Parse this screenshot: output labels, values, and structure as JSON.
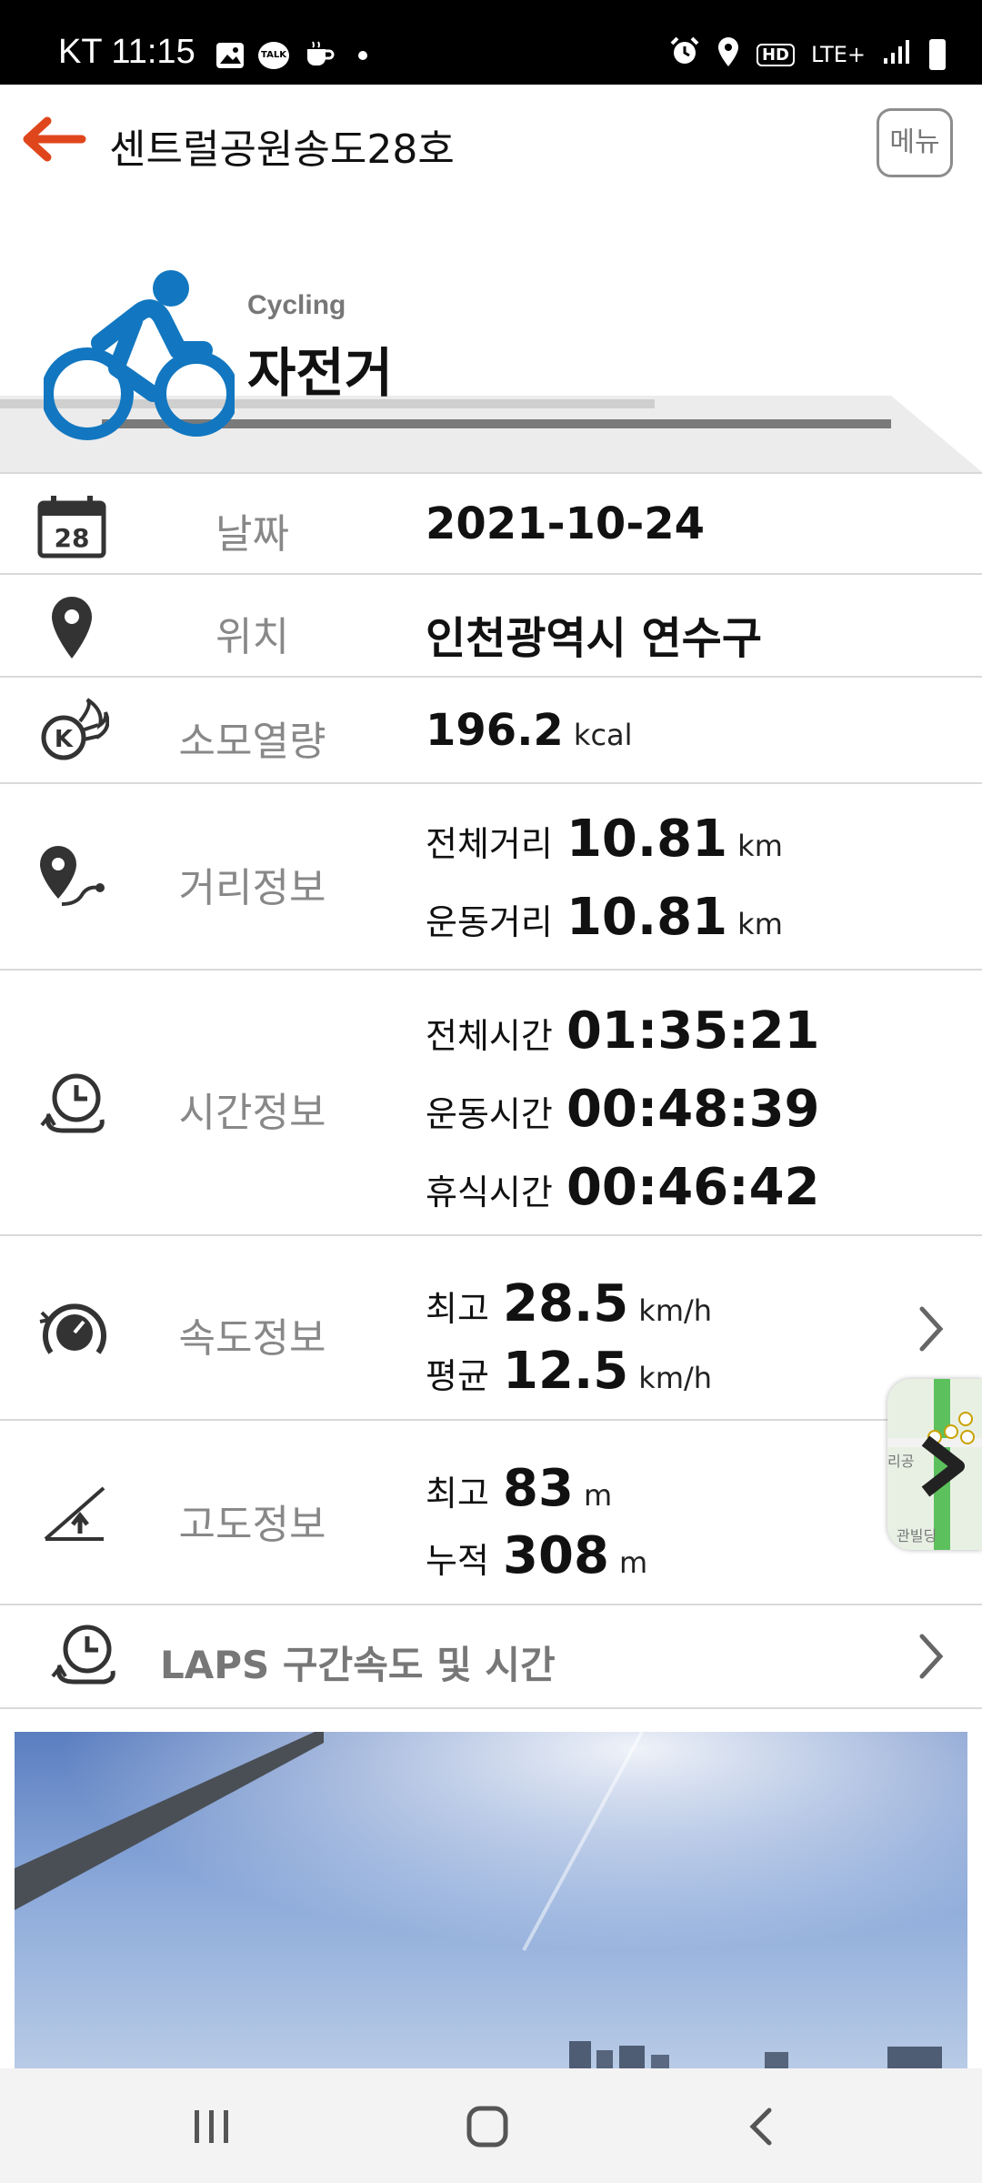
{
  "status_bar": {
    "carrier_time": "KT 11:15",
    "icons_left": [
      "gallery-icon",
      "kakaotalk-icon",
      "coffee-icon"
    ],
    "icons_right": [
      "alarm-icon",
      "location-icon",
      "hd-icon",
      "lte-icon",
      "signal-icon",
      "battery-icon"
    ],
    "network_label": "LTE+",
    "hd_label": "HD",
    "talk_label": "TALK"
  },
  "app_bar": {
    "title": "센트럴공원송도28호",
    "menu_label": "메뉴",
    "accent_color": "#e0461c"
  },
  "hero": {
    "activity_en": "Cycling",
    "activity_ko": "자전거",
    "icon_color": "#1277c0"
  },
  "rows": {
    "date": {
      "label": "날짜",
      "value": "2021-10-24",
      "icon_text": "28"
    },
    "location": {
      "label": "위치",
      "value": "인천광역시 연수구"
    },
    "calories": {
      "label": "소모열량",
      "value": "196.2",
      "unit": "kcal"
    },
    "distance": {
      "label": "거리정보",
      "total_label": "전체거리",
      "total_value": "10.81",
      "total_unit": "km",
      "active_label": "운동거리",
      "active_value": "10.81",
      "active_unit": "km"
    },
    "time": {
      "label": "시간정보",
      "total_label": "전체시간",
      "total_value": "01:35:21",
      "active_label": "운동시간",
      "active_value": "00:48:39",
      "rest_label": "휴식시간",
      "rest_value": "00:46:42"
    },
    "speed": {
      "label": "속도정보",
      "max_label": "최고",
      "max_value": "28.5",
      "max_unit": "km/h",
      "avg_label": "평균",
      "avg_value": "12.5",
      "avg_unit": "km/h"
    },
    "altitude": {
      "label": "고도정보",
      "max_label": "최고",
      "max_value": "83",
      "max_unit": "m",
      "cum_label": "누적",
      "cum_value": "308",
      "cum_unit": "m"
    },
    "laps": {
      "label": "LAPS 구간속도 및 시간"
    }
  },
  "map_thumb": {
    "text_left": "리공",
    "text_bottom": "관빌딩"
  }
}
